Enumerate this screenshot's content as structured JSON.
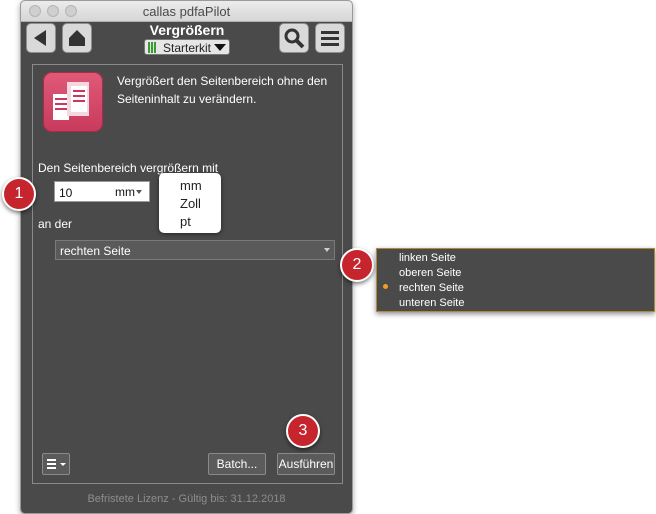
{
  "window": {
    "title": "callas pdfaPilot"
  },
  "toolbar": {
    "title": "Vergrößern",
    "kit_label": "Starterkit"
  },
  "description": "Vergrößert den Seitenbereich ohne den Seiteninhalt zu verändern.",
  "form": {
    "enlarge_label": "Den Seitenbereich vergrößern mit",
    "amount_value": "10",
    "unit_value": "mm",
    "unit_options": [
      "mm",
      "Zoll",
      "pt"
    ],
    "side_label": "an der",
    "side_value": "rechten Seite",
    "side_options": [
      "linken Seite",
      "oberen Seite",
      "rechten Seite",
      "unteren Seite"
    ],
    "side_selected_index": 2
  },
  "buttons": {
    "batch": "Batch...",
    "run": "Ausführen"
  },
  "license": "Befristete Lizenz - Gültig bis: 31.12.2018",
  "callouts": [
    "1",
    "2",
    "3"
  ],
  "colors": {
    "accent_red": "#c7252d",
    "selected_dot": "#f0a020",
    "kit_green": "#3a9b2f"
  },
  "icons": [
    "back-arrow-icon",
    "home-icon",
    "search-icon",
    "hamburger-menu-icon",
    "list-menu-icon",
    "app-enlarge-icon"
  ]
}
